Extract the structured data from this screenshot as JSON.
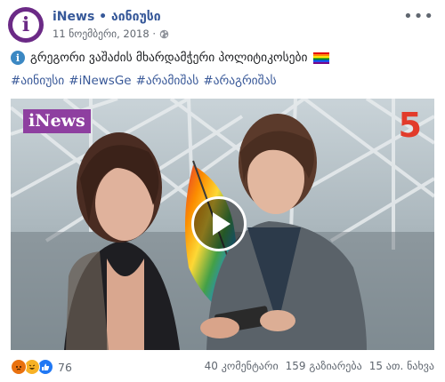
{
  "header": {
    "avatar_letter": "i",
    "page_name": "iNews • აინიუსი",
    "date": "11 ნოემბერი, 2018 ·",
    "audience_icon": "globe-icon"
  },
  "post": {
    "text": "გრეგორი ვაშაძის მხარდამჭერი პოლიტიკოსები",
    "leading_icon": "info-icon",
    "trailing_icon": "rainbow-flag-icon",
    "hashtags": [
      "#აინიუსი",
      "#iNewsGe",
      "#არამიშას",
      "#არაგრიშას"
    ]
  },
  "video": {
    "brand_badge": "iNews",
    "channel_logo": "5",
    "play_icon": "play-icon",
    "colors": {
      "brand": "#8e3fa0",
      "channel": "#e23b2b"
    }
  },
  "footer": {
    "reaction_icons": [
      "angry-icon",
      "haha-icon",
      "like-icon"
    ],
    "reaction_count": "76",
    "comments": "40 კომენტარი",
    "shares": "159 გაზიარება",
    "views": "15 ათ. ნახვა"
  },
  "colors": {
    "link": "#365899",
    "accent": "#6b2a86"
  }
}
